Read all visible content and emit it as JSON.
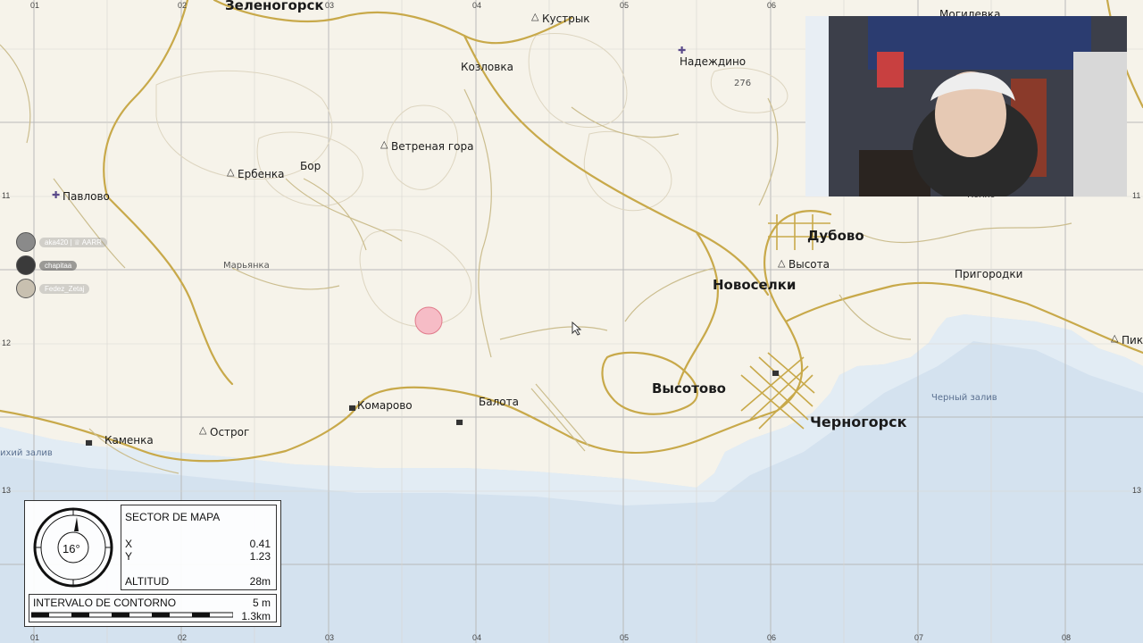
{
  "colors": {
    "land": "#f6f3ea",
    "sea": "#d4e2ef",
    "sea_shallow": "#e2ecf4",
    "road_main": "#c8a94a",
    "road_minor": "#cbbd8e",
    "grid": "#b9b9b9",
    "marker_fill": "#f6bcc6",
    "marker_stroke": "#e07a8a"
  },
  "grid": {
    "columns": [
      "01",
      "02",
      "03",
      "04",
      "05",
      "06",
      "07",
      "08"
    ],
    "rows": [
      "11",
      "12",
      "13"
    ]
  },
  "towns": {
    "zelenogorsk": "Зеленогорск",
    "kustryk": "Кустрык",
    "mogilevka": "Могилевка",
    "kozlovka": "Козловка",
    "nadezhdino": "Надеждино",
    "elev_276": "276",
    "vetrenaya": "Ветреная гора",
    "bor": "Бор",
    "erbenka": "Ербенка",
    "pavlovo": "Павлово",
    "maryanka": "Марьянка",
    "dubovo": "Дубово",
    "vysota": "Высота",
    "novoselki": "Новоселки",
    "prigorodki": "Пригородки",
    "pik": "Пик",
    "vysotovo": "Высотово",
    "komarovo": "Комарово",
    "balota": "Балота",
    "chernogorsk": "Черногорск",
    "cherny_zaliv": "Черный залив",
    "kamenka": "Каменка",
    "ostrog": "Острог",
    "tikhy_zaliv": "ихий залив",
    "kolkhoz_partial": "Колхо"
  },
  "players": [
    {
      "name": "aka420 | ♕ AARR",
      "state": "dim"
    },
    {
      "name": "chapitaa",
      "state": "active"
    },
    {
      "name": "Fedez_Zetaj",
      "state": "dim"
    }
  ],
  "hud": {
    "compass_heading": "16°",
    "sector_title": "SECTOR DE MAPA",
    "x_label": "X",
    "x_value": "0.41",
    "y_label": "Y",
    "y_value": "1.23",
    "altitude_label": "ALTITUD",
    "altitude_value": "28m",
    "contour_label": "INTERVALO DE CONTORNO",
    "contour_value": "5 m",
    "scale_value": "1.3km"
  }
}
